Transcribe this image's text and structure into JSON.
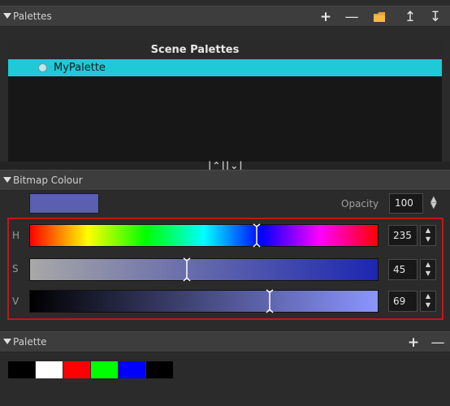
{
  "palettes_panel": {
    "title": "Palettes",
    "scene_header": "Scene Palettes",
    "items": [
      {
        "label": "MyPalette",
        "selected": true
      }
    ],
    "toolbar": [
      "add-icon",
      "remove-icon",
      "folder-icon",
      "move-up-icon",
      "move-down-icon"
    ]
  },
  "bitmap_panel": {
    "title": "Bitmap Colour",
    "swatch_color": "#5a5fb0",
    "opacity_label": "Opacity",
    "opacity_value": "100",
    "sliders": [
      {
        "label": "H",
        "value": "235",
        "fraction": 0.653
      },
      {
        "label": "S",
        "value": "45",
        "fraction": 0.45
      },
      {
        "label": "V",
        "value": "69",
        "fraction": 0.69
      }
    ]
  },
  "palette_panel": {
    "title": "Palette",
    "colors": [
      "#000000",
      "#ffffff",
      "#ff0000",
      "#00ff00",
      "#0000ff",
      "#000000"
    ]
  },
  "accent_color": "#1fc9d8",
  "highlight_border_color": "#c01818"
}
